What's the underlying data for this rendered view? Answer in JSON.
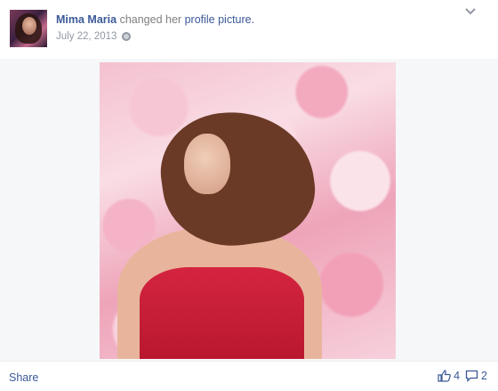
{
  "post": {
    "author": "Mima Maria",
    "action": "changed her",
    "link_text": "profile picture.",
    "date": "July 22, 2013",
    "audience_icon": "globe-icon"
  },
  "photo": {
    "description_icon": "profile-photo"
  },
  "footer": {
    "share_label": "Share",
    "like_count": "4",
    "comment_count": "2"
  },
  "colors": {
    "link": "#3b5998",
    "muted": "#9197a3",
    "photo_background": "#f6f7f9"
  }
}
